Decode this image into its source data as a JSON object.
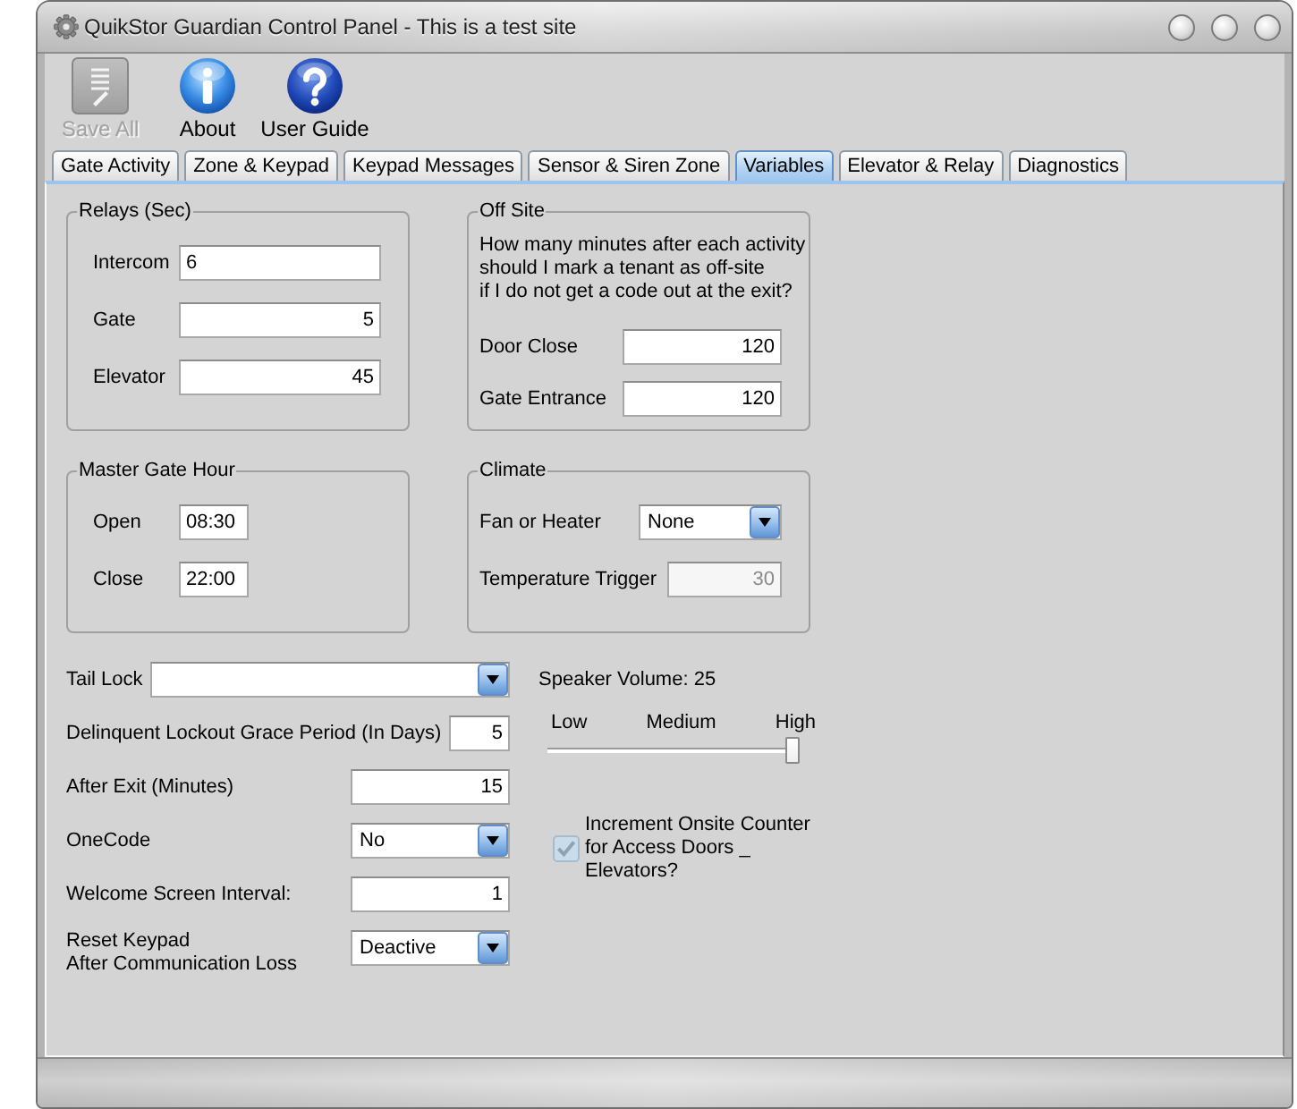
{
  "window": {
    "title": "QuikStor Guardian Control Panel - This is a test site"
  },
  "toolbar": [
    {
      "kind": "save",
      "label": "Save All",
      "disabled": true
    },
    {
      "kind": "info",
      "label": "About",
      "disabled": false
    },
    {
      "kind": "help",
      "label": "User Guide",
      "disabled": false
    }
  ],
  "tabs": [
    {
      "label": "Gate Activity",
      "selected": false
    },
    {
      "label": "Zone & Keypad",
      "selected": false
    },
    {
      "label": "Keypad Messages",
      "selected": false
    },
    {
      "label": "Sensor & Siren Zone",
      "selected": false
    },
    {
      "label": "Variables",
      "selected": true
    },
    {
      "label": "Elevator & Relay",
      "selected": false
    },
    {
      "label": "Diagnostics",
      "selected": false
    }
  ],
  "relays": {
    "title": "Relays (Sec)",
    "fields": [
      {
        "label": "Intercom",
        "kind": "text",
        "value": "6"
      },
      {
        "label": "Gate",
        "kind": "number",
        "value": "5"
      },
      {
        "label": "Elevator",
        "kind": "number",
        "value": "45"
      }
    ]
  },
  "off_site": {
    "title": "Off Site",
    "description": "How many minutes after each activity\nshould I mark a tenant as off-site\nif I do not get a code out at the exit?",
    "fields": [
      {
        "label": "Door Close",
        "kind": "number",
        "value": "120"
      },
      {
        "label": "Gate Entrance",
        "kind": "number",
        "value": "120"
      }
    ]
  },
  "master_gate_hour": {
    "title": "Master Gate Hour",
    "fields": [
      {
        "label": "Open",
        "kind": "text",
        "value": "08:30"
      },
      {
        "label": "Close",
        "kind": "text",
        "value": "22:00"
      }
    ]
  },
  "climate": {
    "title": "Climate",
    "fields": [
      {
        "label": "Fan or Heater",
        "kind": "select",
        "value": "None",
        "disabled": false
      },
      {
        "label": "Temperature Trigger",
        "kind": "number",
        "value": "30",
        "disabled": true
      }
    ]
  },
  "tail_lock": {
    "label": "Tail Lock"
  },
  "settings": [
    {
      "label": "Delinquent Lockout Grace Period (In Days)",
      "kind": "number",
      "value": "5"
    },
    {
      "label": "After Exit (Minutes)",
      "kind": "number",
      "value": "15"
    },
    {
      "label": "OneCode",
      "kind": "select",
      "value": "No"
    },
    {
      "label": "Welcome Screen Interval:",
      "kind": "number",
      "value": "1"
    },
    {
      "label": "Reset Keypad\nAfter Communication Loss",
      "kind": "select",
      "value": "Deactive"
    }
  ],
  "speaker_volume": {
    "label": "Speaker Volume: 25",
    "scale": [
      "Low",
      "Medium",
      "High"
    ],
    "level": 1
  },
  "onsite_counter": {
    "label": "Increment Onsite Counter\nfor Access Doors _\nElevators?",
    "checked": true,
    "disabled": true
  }
}
